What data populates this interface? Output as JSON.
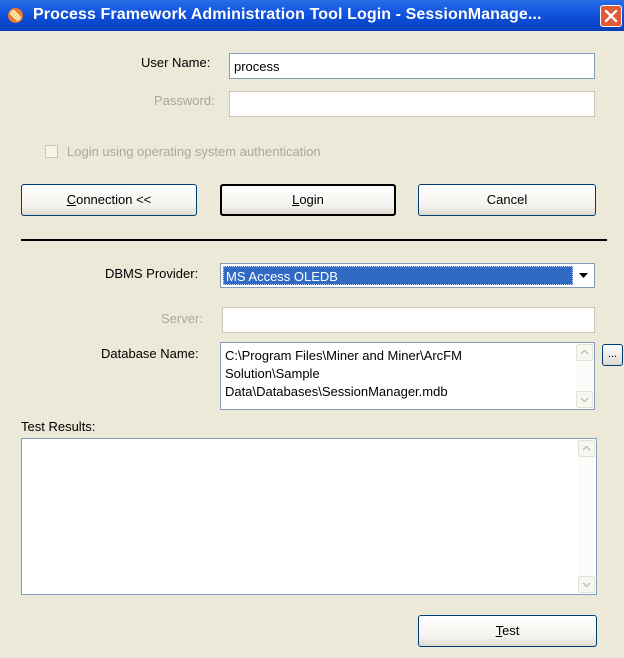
{
  "window": {
    "title": "Process Framework Administration Tool Login - SessionManage..."
  },
  "login": {
    "username_label": "User Name:",
    "username_value": "process",
    "password_label": "Password:",
    "password_value": "",
    "os_auth_label": "Login using operating system authentication",
    "os_auth_checked": false
  },
  "buttons": {
    "connection": {
      "mnemonic": "C",
      "rest": "onnection <<"
    },
    "login": {
      "mnemonic": "L",
      "rest": "ogin"
    },
    "cancel": "Cancel",
    "test": {
      "mnemonic": "T",
      "rest": "est"
    },
    "browse": "..."
  },
  "connection": {
    "dbms_label": "DBMS Provider:",
    "dbms_value": "MS Access OLEDB",
    "server_label": "Server:",
    "server_value": "",
    "database_label": "Database Name:",
    "database_value": "C:\\Program Files\\Miner and Miner\\ArcFM\nSolution\\Sample\nData\\Databases\\SessionManager.mdb"
  },
  "test": {
    "results_label": "Test Results:",
    "results_value": ""
  },
  "icons": [
    "app-icon",
    "close-icon",
    "dropdown-arrow-icon",
    "scroll-up-icon",
    "scroll-down-icon"
  ]
}
